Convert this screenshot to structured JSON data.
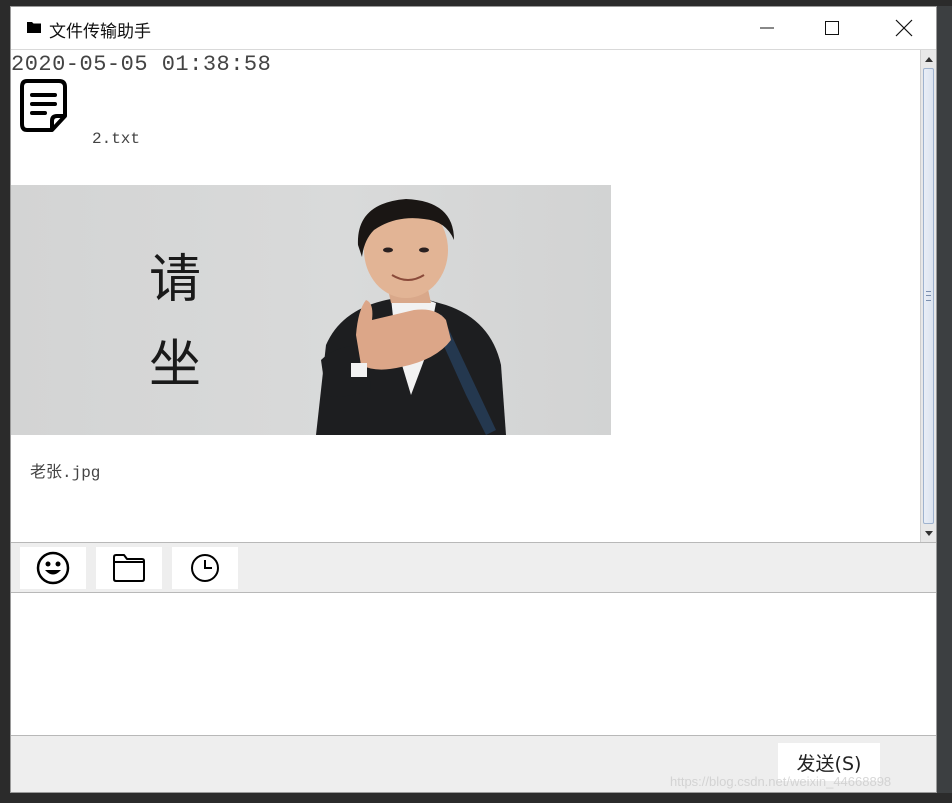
{
  "window": {
    "title": "文件传输助手"
  },
  "messages": {
    "timestamp": "2020-05-05 01:38:58",
    "file_name": "2.txt",
    "image_caption_line1": "请",
    "image_caption_line2": "坐",
    "image_name": "老张.jpg"
  },
  "toolbar": {
    "icons": [
      "smiley-icon",
      "folder-icon",
      "clock-icon"
    ]
  },
  "bottom": {
    "send_label": "发送(S)"
  },
  "watermark": "https://blog.csdn.net/weixin_44668898",
  "colors": {
    "toolbar_bg": "#eeeeee",
    "window_bg": "#ffffff",
    "scroll_thumb": "#dce4f0"
  }
}
